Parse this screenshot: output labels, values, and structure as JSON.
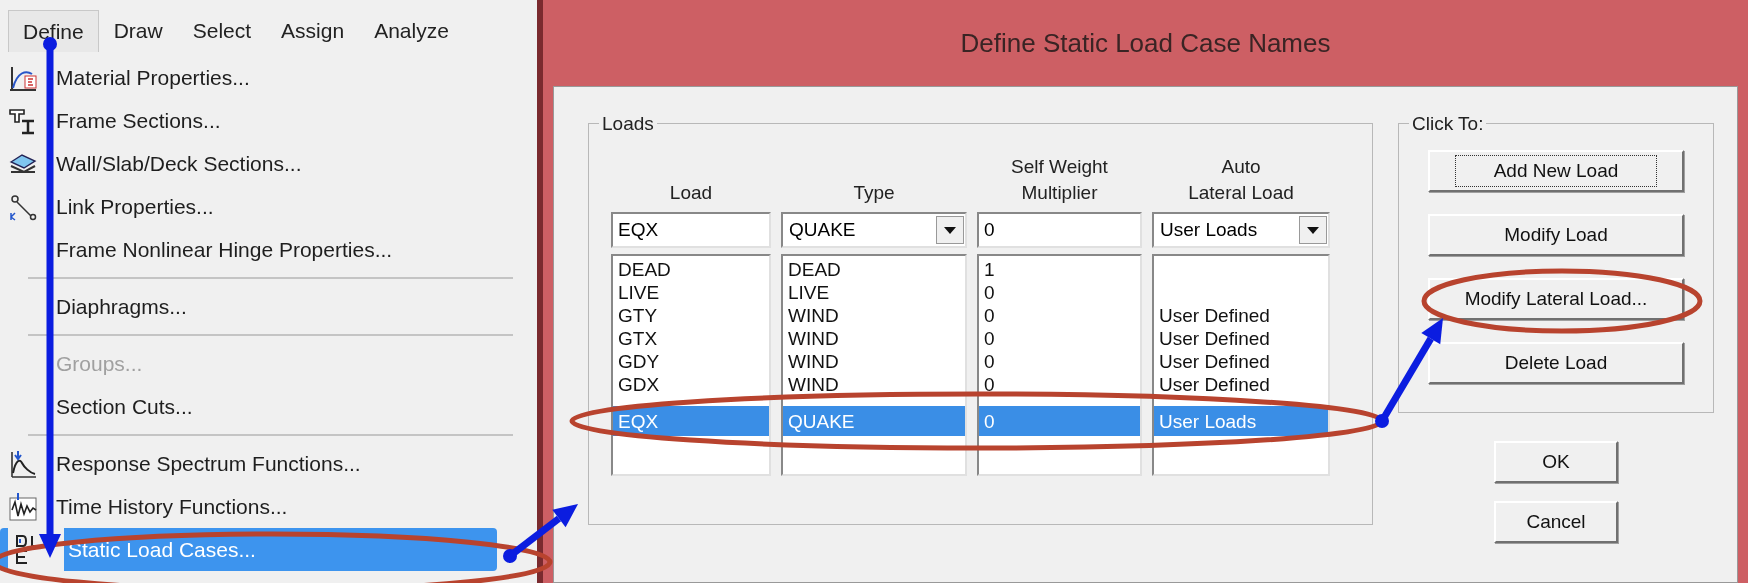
{
  "menu_bar": [
    {
      "label": "Define",
      "selected": true
    },
    {
      "label": "Draw",
      "selected": false
    },
    {
      "label": "Select",
      "selected": false
    },
    {
      "label": "Assign",
      "selected": false
    },
    {
      "label": "Analyze",
      "selected": false
    }
  ],
  "menu_items": [
    {
      "kind": "item",
      "label": "Material Properties...",
      "has_icon": true,
      "disabled": false,
      "selected": false
    },
    {
      "kind": "item",
      "label": "Frame Sections...",
      "has_icon": true,
      "disabled": false,
      "selected": false
    },
    {
      "kind": "item",
      "label": "Wall/Slab/Deck Sections...",
      "has_icon": true,
      "disabled": false,
      "selected": false
    },
    {
      "kind": "item",
      "label": "Link Properties...",
      "has_icon": true,
      "disabled": false,
      "selected": false
    },
    {
      "kind": "item",
      "label": "Frame Nonlinear Hinge Properties...",
      "has_icon": false,
      "disabled": false,
      "selected": false
    },
    {
      "kind": "separator"
    },
    {
      "kind": "item",
      "label": "Diaphragms...",
      "has_icon": false,
      "disabled": false,
      "selected": false
    },
    {
      "kind": "separator"
    },
    {
      "kind": "item",
      "label": "Groups...",
      "has_icon": false,
      "disabled": true,
      "selected": false
    },
    {
      "kind": "item",
      "label": "Section Cuts...",
      "has_icon": false,
      "disabled": false,
      "selected": false
    },
    {
      "kind": "separator"
    },
    {
      "kind": "item",
      "label": "Response Spectrum Functions...",
      "has_icon": true,
      "disabled": false,
      "selected": false
    },
    {
      "kind": "item",
      "label": "Time History Functions...",
      "has_icon": true,
      "disabled": false,
      "selected": false
    },
    {
      "kind": "item",
      "label": "Static Load Cases...",
      "has_icon": true,
      "disabled": false,
      "selected": true
    }
  ],
  "dialog": {
    "title": "Define Static Load Case Names",
    "loads_group": {
      "label": "Loads",
      "columns": [
        {
          "lines": [
            "Load"
          ]
        },
        {
          "lines": [
            "Type"
          ]
        },
        {
          "lines": [
            "Self Weight",
            "Multiplier"
          ]
        },
        {
          "lines": [
            "Auto",
            "Lateral Load"
          ]
        }
      ],
      "inputs": [
        {
          "kind": "text",
          "value": "EQX"
        },
        {
          "kind": "dropdown",
          "value": "QUAKE"
        },
        {
          "kind": "text",
          "value": "0"
        },
        {
          "kind": "dropdown",
          "value": "User Loads"
        }
      ],
      "rows": [
        {
          "load": "DEAD",
          "type": "DEAD",
          "multiplier": "1",
          "selected": false
        },
        {
          "load": "LIVE",
          "type": "LIVE",
          "multiplier": "0",
          "selected": false
        },
        {
          "load": "GTY",
          "type": "WIND",
          "multiplier": "0",
          "lateral": "User Defined",
          "selected": false
        },
        {
          "load": "GTX",
          "type": "WIND",
          "multiplier": "0",
          "lateral": "User Defined",
          "selected": false
        },
        {
          "load": "GDY",
          "type": "WIND",
          "multiplier": "0",
          "lateral": "User Defined",
          "selected": false
        },
        {
          "load": "GDX",
          "type": "WIND",
          "multiplier": "0",
          "lateral": "User Defined",
          "selected": false
        },
        {
          "load": "EQX",
          "type": "QUAKE",
          "multiplier": "0",
          "lateral": "User Loads",
          "selected": true
        }
      ]
    },
    "click_to_group": {
      "label": "Click To:",
      "buttons": [
        {
          "label": "Add New Load",
          "focused": true
        },
        {
          "label": "Modify Load",
          "focused": false
        },
        {
          "label": "Modify Lateral Load...",
          "focused": false
        },
        {
          "label": "Delete Load",
          "focused": false
        }
      ]
    },
    "buttons": [
      "OK",
      "Cancel"
    ]
  }
}
